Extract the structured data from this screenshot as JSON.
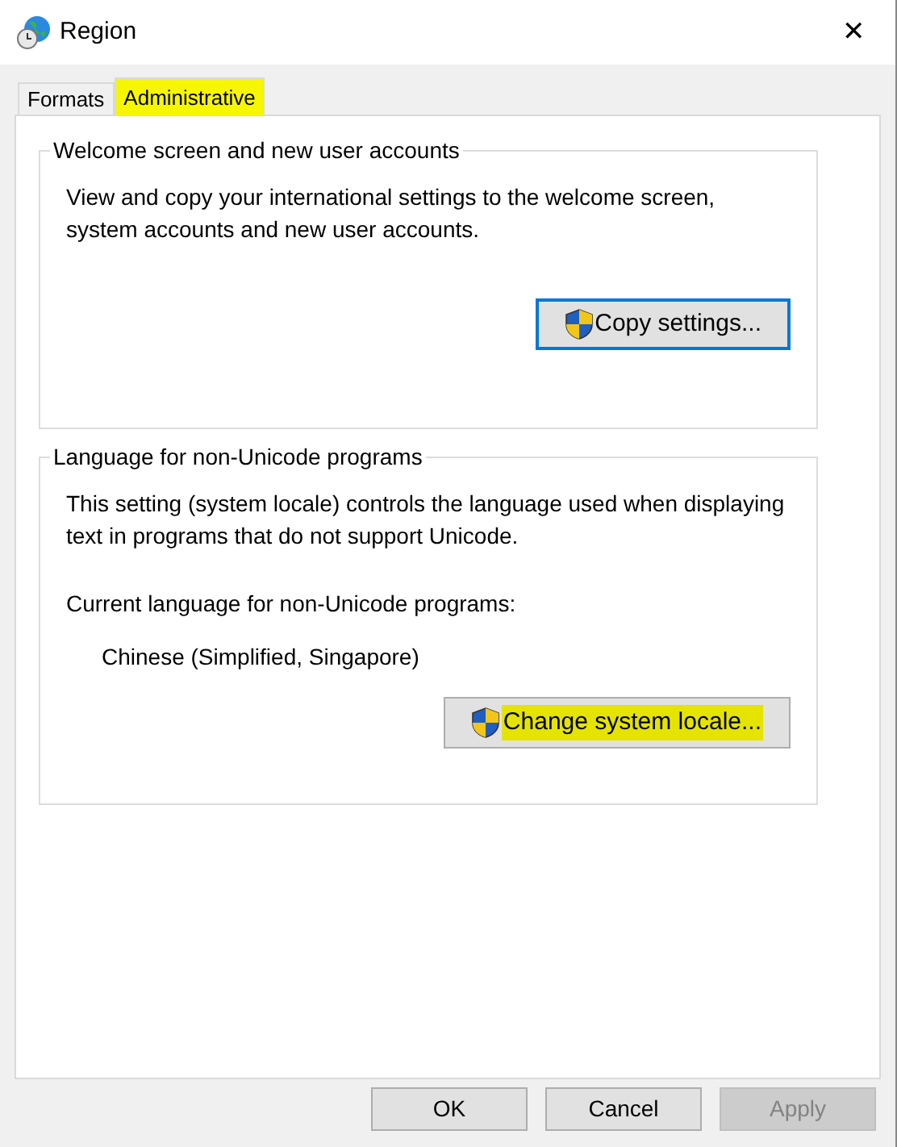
{
  "window": {
    "title": "Region",
    "close": "✕"
  },
  "tabs": [
    {
      "label": "Formats",
      "selected": false,
      "highlighted": false
    },
    {
      "label": "Administrative",
      "selected": true,
      "highlighted": true
    }
  ],
  "groups": [
    {
      "title": "Welcome screen and new user accounts",
      "text": "View and copy your international settings to the welcome screen, system accounts and new user accounts.",
      "button": {
        "label": "Copy settings...",
        "focused": true,
        "highlighted": false
      }
    },
    {
      "title": "Language for non-Unicode programs",
      "text": "This setting (system locale) controls the language used when displaying text in programs that do not support Unicode.",
      "current_label": "Current language for non-Unicode programs:",
      "current_value": "Chinese (Simplified, Singapore)",
      "button": {
        "label": "Change system locale...",
        "focused": false,
        "highlighted": true
      }
    }
  ],
  "buttons": [
    {
      "label": "OK",
      "disabled": false
    },
    {
      "label": "Cancel",
      "disabled": false
    },
    {
      "label": "Apply",
      "disabled": true
    }
  ]
}
